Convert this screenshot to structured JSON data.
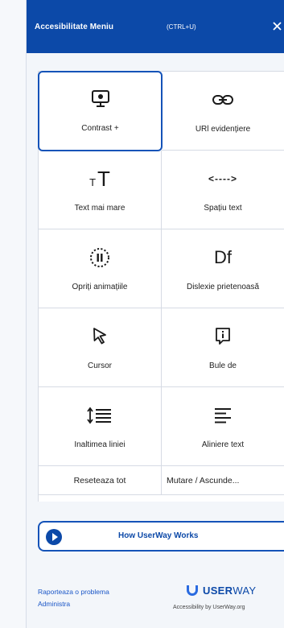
{
  "header": {
    "title": "Accesibilitate Meniu",
    "shortcut": "(CTRL+U)"
  },
  "tiles": [
    {
      "label": "Contrast +",
      "icon": "monitor-contrast-icon",
      "active": true
    },
    {
      "label": "URl evidențiere",
      "icon": "link-icon"
    },
    {
      "label": "Text mai mare",
      "icon": "text-size-icon"
    },
    {
      "label": "Spațiu text",
      "icon": "text-spacing-icon"
    },
    {
      "label": "Opriți animațiile",
      "icon": "pause-animation-icon"
    },
    {
      "label": "Dislexie prietenoasă",
      "icon": "dyslexia-font-icon"
    },
    {
      "label": "Cursor",
      "icon": "cursor-icon"
    },
    {
      "label": "Bule de",
      "icon": "tooltip-bubble-icon"
    },
    {
      "label": "Inaltimea liniei",
      "icon": "line-height-icon"
    },
    {
      "label": "Aliniere text",
      "icon": "text-align-icon"
    }
  ],
  "buttons": {
    "reset": "Reseteaza tot",
    "move_hide": "Mutare / Ascunde..."
  },
  "how_it_works": "How UserWay Works",
  "footer": {
    "report": "Raporteaza o problema",
    "manage": "Administra",
    "brand_bold": "USER",
    "brand_light": "WAY",
    "tagline": "Accessibility by UserWay.org"
  },
  "colors": {
    "header_bg": "#0c49a8",
    "accent": "#1553b8",
    "link": "#1a56c7"
  },
  "icon_texts": {
    "dyslexia": "Df",
    "text_small": "T",
    "text_large": "T",
    "spacing": "<---->"
  }
}
